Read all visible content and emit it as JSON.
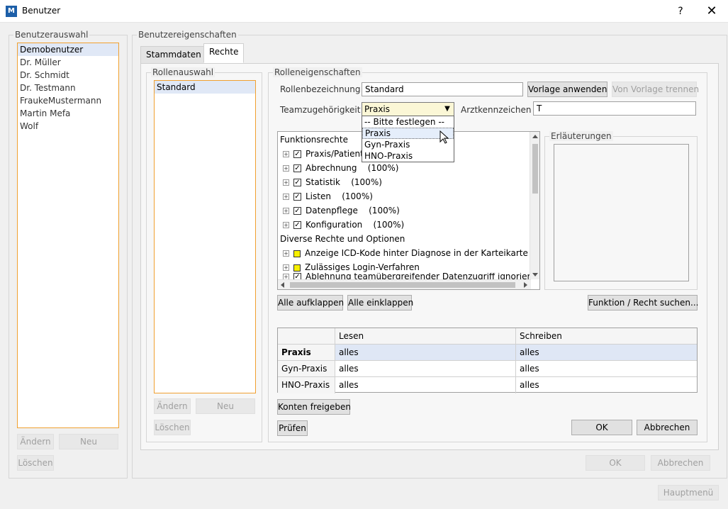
{
  "window": {
    "title": "Benutzer",
    "help": "?",
    "close": "✕",
    "icon": "M"
  },
  "user_selection": {
    "legend": "Benutzerauswahl",
    "users": [
      "Demobenutzer",
      "Dr. Müller",
      "Dr. Schmidt",
      "Dr. Testmann",
      "FraukeMustermann",
      "Martin Mefa",
      "Wolf"
    ],
    "buttons": {
      "edit": "Ändern",
      "new": "Neu",
      "delete": "Löschen"
    }
  },
  "user_properties": {
    "legend": "Benutzereigenschaften",
    "tabs": [
      "Stammdaten",
      "Rechte"
    ]
  },
  "roles": {
    "legend": "Rollenauswahl",
    "items": [
      "Standard"
    ],
    "buttons": {
      "edit": "Ändern",
      "new": "Neu",
      "delete": "Löschen"
    }
  },
  "role_props": {
    "legend": "Rolleneigenschaften",
    "name_label": "Rollenbezeichnung",
    "name_value": "Standard",
    "apply_template": "Vorlage anwenden",
    "detach_template": "Von Vorlage trennen",
    "team_label": "Teamzugehörigkeit",
    "team_value": "Praxis",
    "team_arrow": "▼",
    "team_options": [
      "-- Bitte festlegen --",
      "Praxis",
      "Gyn-Praxis",
      "HNO-Praxis"
    ],
    "doctor_label": "Arztkennzeichen",
    "doctor_value": "T"
  },
  "tree": {
    "section1": "Funktionsrechte",
    "items1": [
      {
        "label": "Praxis/Patienten",
        "pct": ""
      },
      {
        "label": "Abrechnung",
        "pct": "(100%)"
      },
      {
        "label": "Statistik",
        "pct": "(100%)"
      },
      {
        "label": "Listen",
        "pct": "(100%)"
      },
      {
        "label": "Datenpflege",
        "pct": "(100%)"
      },
      {
        "label": "Konfiguration",
        "pct": "(100%)"
      }
    ],
    "section2": "Diverse Rechte und Optionen",
    "items2": [
      "Anzeige ICD-Kode hinter Diagnose in der Karteikarte",
      "Zulässiges Login-Verfahren",
      "Ablehnung teamübergreifender Datenzugriff ignorieren"
    ],
    "expand_glyph": "+",
    "check_glyph": "✓"
  },
  "notes": {
    "legend": "Erläuterungen"
  },
  "actions": {
    "expand_all": "Alle aufklappen",
    "collapse_all": "Alle einklappen",
    "search": "Funktion / Recht suchen...",
    "release_accounts": "Konten freigeben",
    "check": "Prüfen",
    "ok": "OK",
    "cancel": "Abbrechen"
  },
  "access_grid": {
    "headers": [
      "",
      "Lesen",
      "Schreiben"
    ],
    "rows": [
      {
        "name": "Praxis",
        "read": "alles",
        "write": "alles"
      },
      {
        "name": "Gyn-Praxis",
        "read": "alles",
        "write": "alles"
      },
      {
        "name": "HNO-Praxis",
        "read": "alles",
        "write": "alles"
      }
    ]
  },
  "bottom": {
    "ok": "OK",
    "cancel": "Abbrechen",
    "main_menu": "Hauptmenü"
  },
  "colors": {
    "accent_border": "#f0a030",
    "selection": "#e0e8f6",
    "combo_bg": "#fbf7d6",
    "yellow_box": "#f7f000",
    "icon_blue": "#1d5fa8"
  }
}
